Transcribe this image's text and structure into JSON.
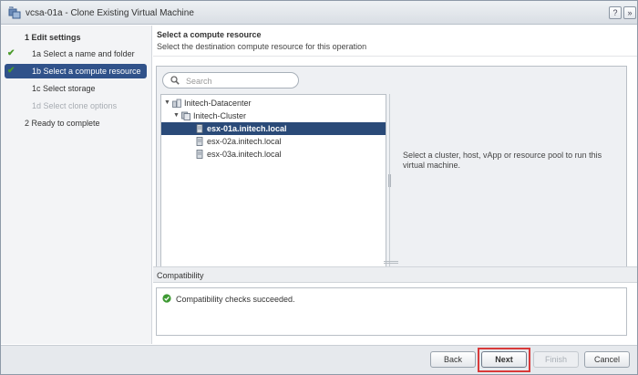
{
  "window": {
    "title": "vcsa-01a - Clone Existing Virtual Machine",
    "help_label": "?",
    "expand_label": "»"
  },
  "sidebar": {
    "steps": [
      {
        "label": "1  Edit settings",
        "state": "normal",
        "check": false
      },
      {
        "label": "1a  Select a name and folder",
        "state": "done",
        "check": true
      },
      {
        "label": "1b  Select a compute resource",
        "state": "selected",
        "check": true
      },
      {
        "label": "1c  Select storage",
        "state": "normal",
        "check": false
      },
      {
        "label": "1d  Select clone options",
        "state": "disabled",
        "check": false
      },
      {
        "label": "2  Ready to complete",
        "state": "normal",
        "check": false
      }
    ]
  },
  "main": {
    "title": "Select a compute resource",
    "subtitle": "Select the destination compute resource for this operation",
    "search_placeholder": "Search",
    "tree": [
      {
        "label": "Initech-Datacenter",
        "icon": "datacenter-icon",
        "expanded": true
      },
      {
        "label": "Initech-Cluster",
        "icon": "cluster-icon",
        "expanded": true
      },
      {
        "label": "esx-01a.initech.local",
        "icon": "host-icon",
        "selected": true
      },
      {
        "label": "esx-02a.initech.local",
        "icon": "host-icon"
      },
      {
        "label": "esx-03a.initech.local",
        "icon": "host-icon"
      }
    ],
    "info_text": "Select a cluster, host, vApp or resource pool to run this virtual machine.",
    "compatibility_title": "Compatibility",
    "compatibility_message": "Compatibility checks succeeded."
  },
  "footer": {
    "back": "Back",
    "next": "Next",
    "finish": "Finish",
    "cancel": "Cancel"
  },
  "colors": {
    "selected": "#30528a",
    "tree_selected": "#2a4a78",
    "check": "#4a9b2a",
    "highlight": "#d93a3a"
  }
}
